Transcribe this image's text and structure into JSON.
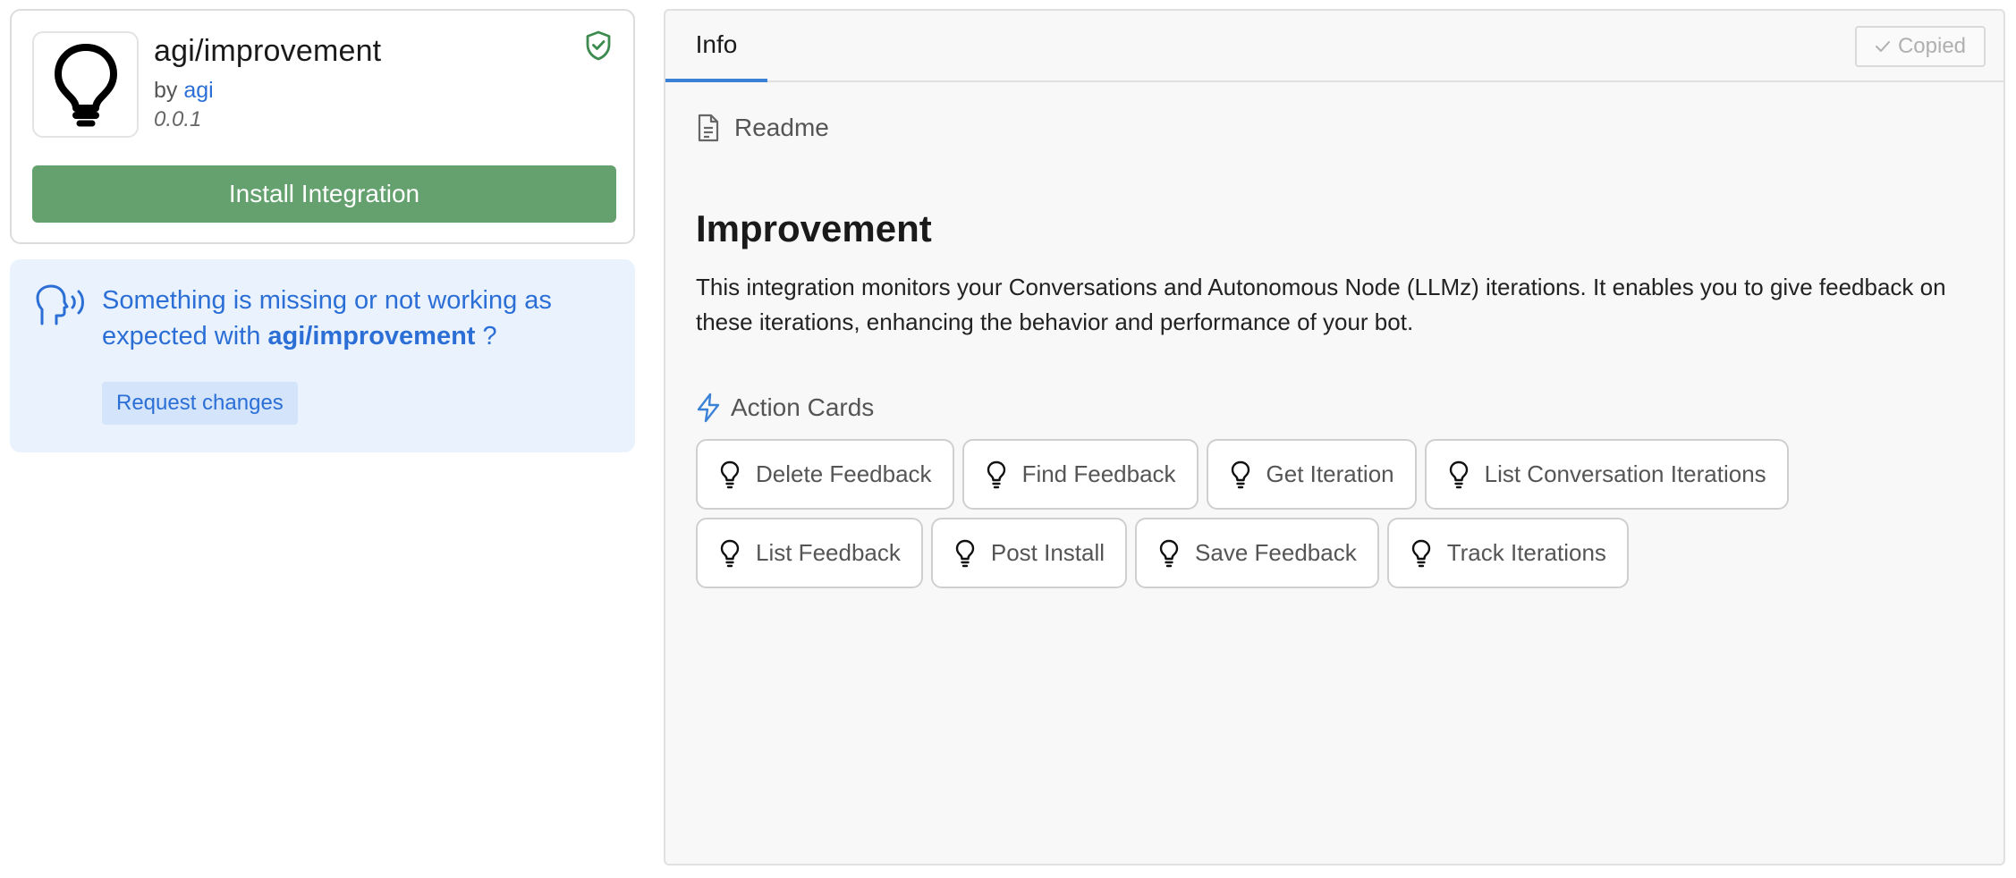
{
  "integration": {
    "title": "agi/improvement",
    "by_label": "by",
    "author": "agi",
    "version": "0.0.1",
    "install_label": "Install Integration",
    "logo_icon": "lightbulb-icon",
    "verified_icon": "shield-check-icon"
  },
  "feedback": {
    "text_before": "Something is missing or not working as expected with",
    "integration_name": "agi/improvement",
    "text_after": "?",
    "request_label": "Request changes"
  },
  "panel": {
    "tabs": [
      {
        "label": "Info",
        "active": true
      }
    ],
    "copied_label": "Copied",
    "readme_label": "Readme",
    "doc_title": "Improvement",
    "doc_body": "This integration monitors your Conversations and Autonomous Node (LLMz) iterations. It enables you to give feedback on these iterations, enhancing the behavior and performance of your bot.",
    "action_cards_heading": "Action Cards",
    "action_cards": [
      {
        "label": "Delete Feedback"
      },
      {
        "label": "Find Feedback"
      },
      {
        "label": "Get Iteration"
      },
      {
        "label": "List Conversation Iterations"
      },
      {
        "label": "List Feedback"
      },
      {
        "label": "Post Install"
      },
      {
        "label": "Save Feedback"
      },
      {
        "label": "Track Iterations"
      }
    ]
  },
  "colors": {
    "install_green": "#64a16e",
    "link_blue": "#2b6fd6",
    "feedback_bg": "#eaf2fd",
    "tab_underline": "#3b82d6"
  }
}
